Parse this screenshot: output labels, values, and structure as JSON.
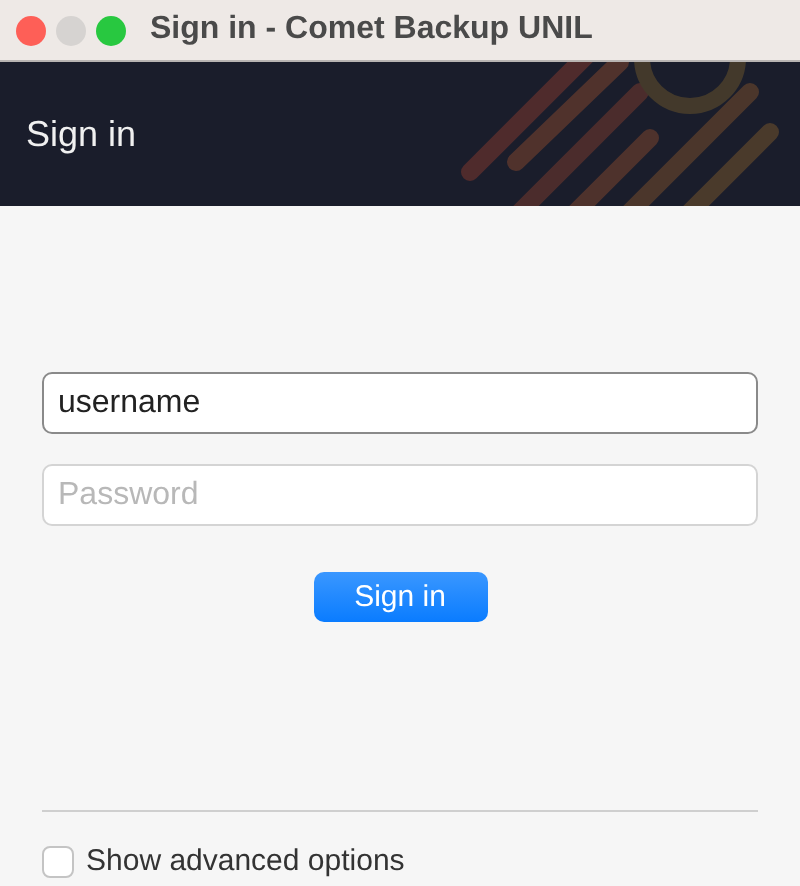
{
  "window": {
    "title": "Sign in - Comet Backup UNIL"
  },
  "header": {
    "title": "Sign in"
  },
  "form": {
    "username": {
      "value": "username",
      "focused": true
    },
    "password": {
      "placeholder": "Password"
    },
    "submit": "Sign in"
  },
  "advanced": {
    "label": "Show advanced options",
    "checked": false
  }
}
